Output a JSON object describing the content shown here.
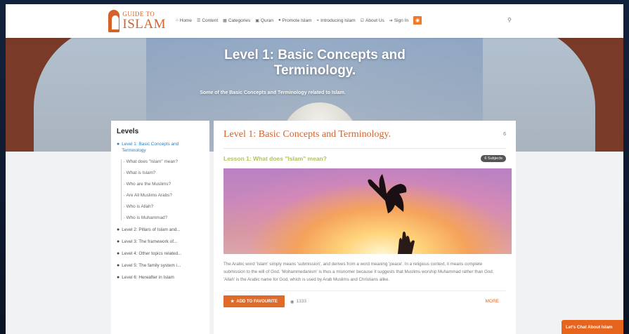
{
  "logo": {
    "top": "GUIDE TO",
    "main": "ISLAM"
  },
  "nav": [
    {
      "icon": "home-icon",
      "glyph": "⌂",
      "label": "Home"
    },
    {
      "icon": "content-icon",
      "glyph": "☰",
      "label": "Content"
    },
    {
      "icon": "categories-icon",
      "glyph": "▦",
      "label": "Categories"
    },
    {
      "icon": "quran-icon",
      "glyph": "▣",
      "label": "Quran"
    },
    {
      "icon": "promote-icon",
      "glyph": "●",
      "label": "Promote Islam"
    },
    {
      "icon": "introducing-icon",
      "glyph": "◒",
      "label": "Introducing Islam"
    },
    {
      "icon": "about-icon",
      "glyph": "☑",
      "label": "About Us"
    },
    {
      "icon": "signin-icon",
      "glyph": "➔",
      "label": "Sign In"
    }
  ],
  "hero": {
    "title": "Level 1: Basic Concepts and Terminology.",
    "subtitle": "Some of the Basic Concepts and Terminology related to Islam."
  },
  "sidebar": {
    "title": "Levels",
    "active": "Level 1: Basic Concepts and Terminology",
    "sub_items": [
      "What does \"Islam\" mean?",
      "What is Islam?",
      "Who are the Muslims?",
      "Are All Muslims Arabs?",
      "Who is Allah?",
      "Who is Muhammad?"
    ],
    "levels": [
      "Level 2: Pillars of Islam and...",
      "Level 3: The framework of...",
      "Level 4: Other topics related...",
      "Level 5: The family system i...",
      "Level 6: Hereafter in Islam"
    ]
  },
  "main": {
    "title": "Level 1: Basic Concepts and Terminology.",
    "count": "6",
    "lesson_title": "Lesson 1: What does \"Islam\" mean?",
    "badge": "6 Subjects",
    "lesson_text": "The Arabic word 'Islam' simply means 'submission', and derives from a word meaning 'peace'. In a religious context, it means complete submission to the will of God. 'Mohammedanism' is thus a misnomer because it suggests that Muslims worship Muhammad rather than God. 'Allah' is the Arabic name for God, which is used by Arab Muslims and Christians alike.",
    "fav_label": "ADD TO FAVOURITE",
    "views": "1333",
    "more": "MORE"
  },
  "chat": {
    "label": "Let's Chat About Islam"
  },
  "colors": {
    "accent": "#e06a2a",
    "brand": "#d4622a",
    "link": "#2a7fc1",
    "lesson": "#b2c25a"
  }
}
